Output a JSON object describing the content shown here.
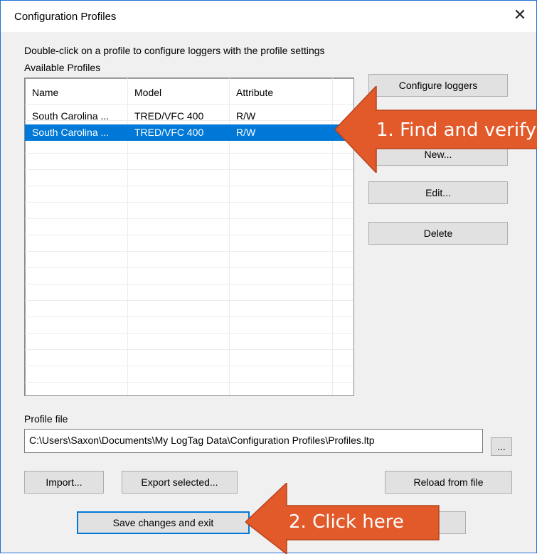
{
  "window": {
    "title": "Configuration Profiles",
    "close_glyph": "✕"
  },
  "instructions": "Double-click on a profile to configure loggers with the profile settings",
  "available_label": "Available Profiles",
  "table": {
    "columns": [
      "Name",
      "Model",
      "Attribute"
    ],
    "rows": [
      {
        "name": "South Carolina ...",
        "model": "TRED/VFC 400",
        "attribute": "R/W",
        "selected": false
      },
      {
        "name": "South Carolina ...",
        "model": "TRED/VFC 400",
        "attribute": "R/W",
        "selected": true
      }
    ]
  },
  "buttons": {
    "configure": "Configure loggers",
    "new": "New...",
    "edit": "Edit...",
    "delete": "Delete",
    "import": "Import...",
    "export": "Export selected...",
    "reload": "Reload from file",
    "save": "Save changes and exit",
    "browse": "...",
    "cancel": ""
  },
  "profile_file": {
    "label": "Profile file",
    "value": "C:\\Users\\Saxon\\Documents\\My LogTag Data\\Configuration Profiles\\Profiles.ltp"
  },
  "callouts": {
    "step1": "1. Find and verify",
    "step2": "2. Click here",
    "color": "#e2592a"
  }
}
